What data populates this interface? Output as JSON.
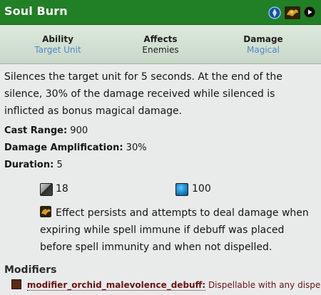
{
  "header": {
    "title": "Soul Burn",
    "icons": [
      "aghanims-scepter-icon",
      "item-orchid-icon",
      "play-icon"
    ],
    "color": "#217f25"
  },
  "stats": [
    {
      "label": "Ability",
      "value": "Target Unit",
      "value_color": "blue"
    },
    {
      "label": "Affects",
      "value": "Enemies",
      "value_color": "default"
    },
    {
      "label": "Damage",
      "value": "Magical",
      "value_color": "blue"
    }
  ],
  "description": "Silences the target unit for 5 seconds. At the end of the silence, 30% of the damage received while silenced is inflicted as bonus magical damage.",
  "properties": [
    {
      "key": "Cast Range:",
      "value": "900"
    },
    {
      "key": "Damage Amplification:",
      "value": "30%"
    },
    {
      "key": "Duration:",
      "value": "5"
    }
  ],
  "costs": {
    "cooldown": {
      "icon": "cooldown-icon",
      "value": "18"
    },
    "mana": {
      "icon": "mana-icon",
      "value": "100"
    }
  },
  "note": {
    "icon": "spell-immunity-icon",
    "text": "Effect persists and attempts to deal damage when expiring while spell immune if debuff was placed before spell immunity and when not dispelled."
  },
  "modifiers": {
    "title": "Modifiers",
    "items": [
      {
        "icon": "debuff-icon",
        "name": "modifier_orchid_malevolence_debuff:",
        "description": "Dispellable with any dispel."
      }
    ]
  }
}
